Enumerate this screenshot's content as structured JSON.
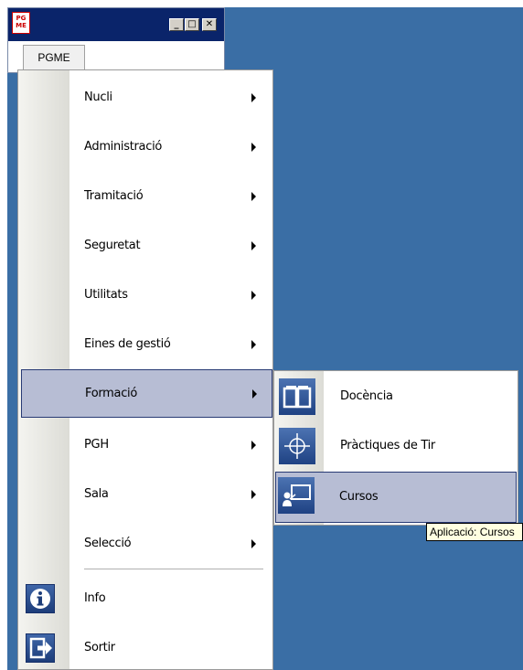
{
  "app_window": {
    "icon_text": "PG ME",
    "tab_label": "PGME",
    "buttons": {
      "minimize": "_",
      "maximize": "□",
      "close": "✕"
    }
  },
  "menu": {
    "items": [
      {
        "label": "Nucli",
        "has_submenu": true
      },
      {
        "label": "Administració",
        "has_submenu": true
      },
      {
        "label": "Tramitació",
        "has_submenu": true
      },
      {
        "label": "Seguretat",
        "has_submenu": true
      },
      {
        "label": "Utilitats",
        "has_submenu": true
      },
      {
        "label": "Eines de gestió",
        "has_submenu": true
      },
      {
        "label": "Formació",
        "has_submenu": true,
        "highlighted": true
      },
      {
        "label": "PGH",
        "has_submenu": true
      },
      {
        "label": "Sala",
        "has_submenu": true
      },
      {
        "label": "Selecció",
        "has_submenu": true
      }
    ],
    "bottom_items": [
      {
        "label": "Info",
        "icon": "info-icon"
      },
      {
        "label": "Sortir",
        "icon": "exit-icon"
      }
    ]
  },
  "submenu": {
    "items": [
      {
        "label": "Docència",
        "icon": "book-icon"
      },
      {
        "label": "Pràctiques de Tir",
        "icon": "crosshair-icon"
      },
      {
        "label": "Cursos",
        "icon": "presentation-icon",
        "highlighted": true
      }
    ]
  },
  "tooltip": {
    "text": "Aplicació: Cursos"
  },
  "colors": {
    "desktop": "#3a6ea5",
    "highlight": "#b7bdd4",
    "highlight_border": "#283a74",
    "icon_blue": "#1d3d7a"
  }
}
